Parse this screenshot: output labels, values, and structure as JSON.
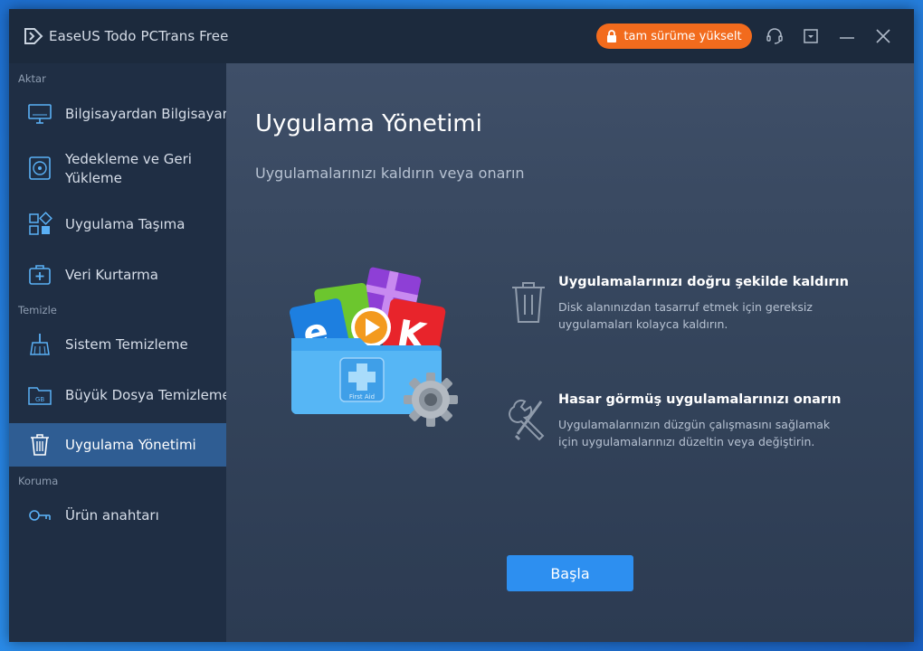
{
  "app": {
    "title": "EaseUS Todo PCTrans Free"
  },
  "titlebar": {
    "upgrade_label": "tam sürüme yükselt",
    "icons": [
      "headset-icon",
      "menu-dropdown-icon",
      "minimize-icon",
      "close-icon"
    ]
  },
  "sidebar": {
    "sections": [
      {
        "label": "Aktar"
      },
      {
        "label": "Temizle"
      },
      {
        "label": "Koruma"
      }
    ],
    "items": [
      {
        "label": "Bilgisayardan Bilgisayara",
        "icon": "monitor-icon"
      },
      {
        "label": "Yedekleme ve Geri Yükleme",
        "icon": "backup-disc-icon"
      },
      {
        "label": "Uygulama Taşıma",
        "icon": "apps-grid-icon"
      },
      {
        "label": "Veri Kurtarma",
        "icon": "first-aid-kit-icon"
      },
      {
        "label": "Sistem Temizleme",
        "icon": "broom-icon"
      },
      {
        "label": "Büyük Dosya Temizleme",
        "icon": "gb-folder-icon"
      },
      {
        "label": "Uygulama Yönetimi",
        "icon": "trash-icon",
        "active": true
      },
      {
        "label": "Ürün anahtarı",
        "icon": "key-icon"
      }
    ]
  },
  "main": {
    "title": "Uygulama Yönetimi",
    "subtitle": "Uygulamalarınızı kaldırın veya onarın",
    "features": [
      {
        "icon": "trash-icon",
        "title": "Uygulamalarınızı doğru şekilde kaldırın",
        "desc": "Disk alanınızdan tasarruf etmek için gereksiz uygulamaları kolayca kaldırın."
      },
      {
        "icon": "tools-icon",
        "title": "Hasar görmüş uygulamalarınızı onarın",
        "desc": "Uygulamalarınızın düzgün çalışmasını sağlamak için uygulamalarınızı düzeltin veya değiştirin."
      }
    ],
    "hero_badge": "First Aid",
    "start_label": "Başla"
  },
  "colors": {
    "accent": "#2d8ff0",
    "upgrade": "#f26b1d",
    "sidebar_bg": "#1f2e44",
    "active_bg": "#2f5d93"
  }
}
